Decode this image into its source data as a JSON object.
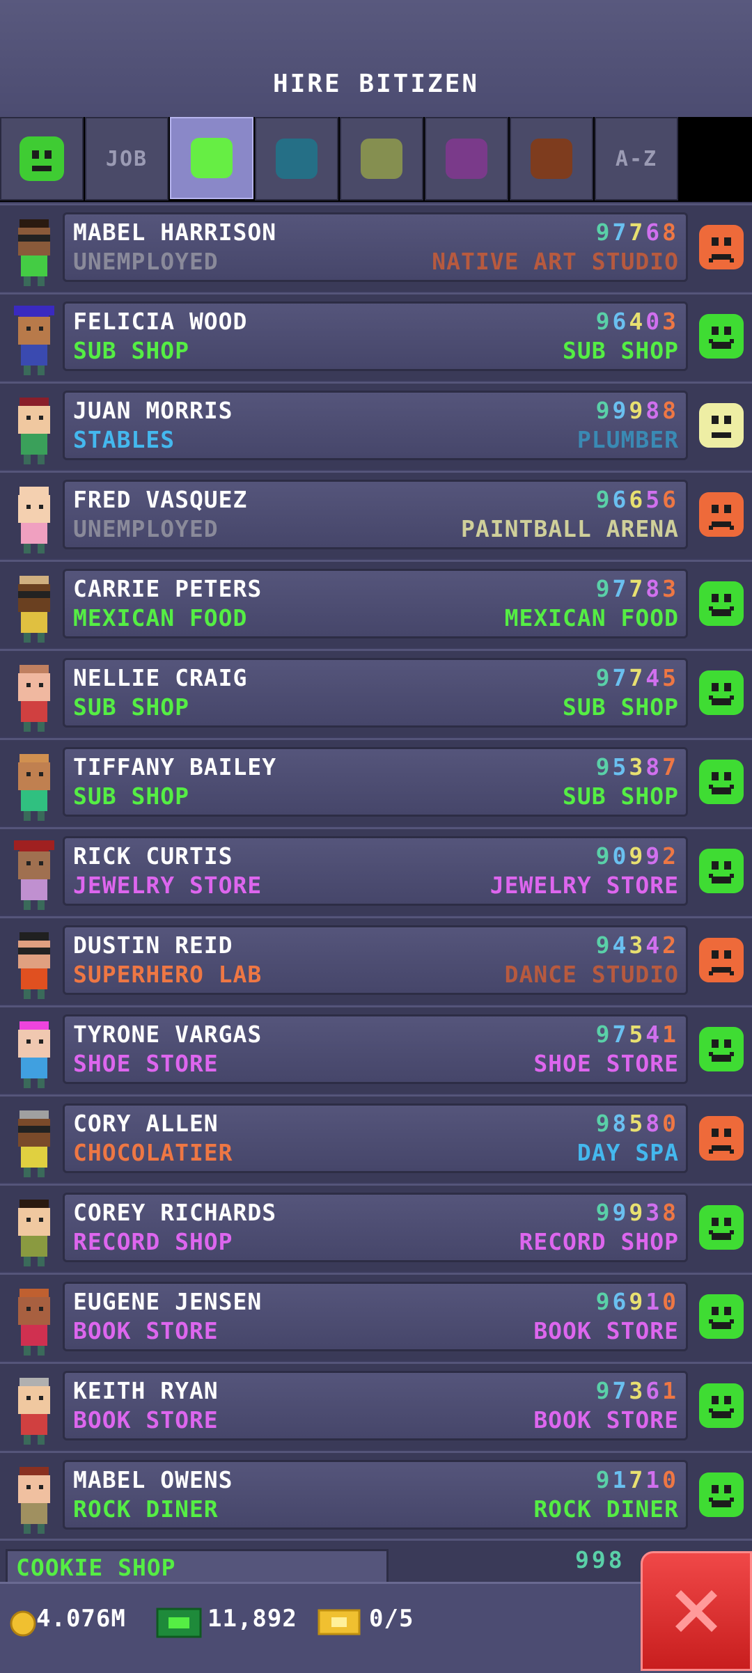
{
  "header": {
    "title": "HIRE BITIZEN"
  },
  "tabs": [
    {
      "type": "mood",
      "icon": "smiley-icon",
      "color": "#3fcc33"
    },
    {
      "type": "text",
      "label": "JOB"
    },
    {
      "type": "swatch",
      "color": "#66ee44",
      "active": true
    },
    {
      "type": "swatch",
      "color": "#256f86"
    },
    {
      "type": "swatch",
      "color": "#858f50"
    },
    {
      "type": "swatch",
      "color": "#7a3a8a"
    },
    {
      "type": "swatch",
      "color": "#7e3c1e"
    },
    {
      "type": "text",
      "label": "A-Z"
    }
  ],
  "colors": {
    "unemployed": "#8a8a9a",
    "food": "#55ee44",
    "service": "#44b8ee",
    "creative": "#dd66ee",
    "recreation": "#ee7744",
    "retail": "#dd66ee",
    "food_dream": "#55ee44",
    "paintball": "#cfcf9a",
    "happy": "#3fdc33",
    "neutral": "#eeeea4",
    "sad": "#ee6a3a"
  },
  "rows": [
    {
      "name": "MABEL HARRISON",
      "job": "UNEMPLOYED",
      "job_color": "#8a8a9a",
      "dream": "NATIVE ART STUDIO",
      "dream_color": "#b75a3f",
      "stats": [
        "9",
        "7",
        "7",
        "6",
        "8"
      ],
      "mood": "sad",
      "avatar": {
        "skin": "#8a5a3a",
        "hair": "#2a1a10",
        "shirt": "#44cc44",
        "glasses": true
      }
    },
    {
      "name": "FELICIA WOOD",
      "job": "SUB SHOP",
      "job_color": "#55ee44",
      "dream": "SUB SHOP",
      "dream_color": "#55ee44",
      "stats": [
        "9",
        "6",
        "4",
        "0",
        "3"
      ],
      "mood": "happy",
      "avatar": {
        "skin": "#b87a4a",
        "hair": "#3a2ac0",
        "shirt": "#3a4ab0",
        "hat": true
      }
    },
    {
      "name": "JUAN MORRIS",
      "job": "STABLES",
      "job_color": "#44b8ee",
      "dream": "PLUMBER",
      "dream_color": "#3a8ab4",
      "stats": [
        "9",
        "9",
        "9",
        "8",
        "8"
      ],
      "mood": "neutral",
      "avatar": {
        "skin": "#f0c8a0",
        "hair": "#8a1e2a",
        "shirt": "#3aa05a"
      }
    },
    {
      "name": "FRED VASQUEZ",
      "job": "UNEMPLOYED",
      "job_color": "#8a8a9a",
      "dream": "PAINTBALL ARENA",
      "dream_color": "#cfcf9a",
      "stats": [
        "9",
        "6",
        "6",
        "5",
        "6"
      ],
      "mood": "sad",
      "avatar": {
        "skin": "#f4d0b0",
        "hair": "#f4d0b0",
        "shirt": "#f0a0c0"
      }
    },
    {
      "name": "CARRIE PETERS",
      "job": "MEXICAN FOOD",
      "job_color": "#55ee44",
      "dream": "MEXICAN FOOD",
      "dream_color": "#55ee44",
      "stats": [
        "9",
        "7",
        "7",
        "8",
        "3"
      ],
      "mood": "happy",
      "avatar": {
        "skin": "#6a4020",
        "hair": "#d0b080",
        "shirt": "#e0c040",
        "glasses": true
      }
    },
    {
      "name": "NELLIE CRAIG",
      "job": "SUB SHOP",
      "job_color": "#55ee44",
      "dream": "SUB SHOP",
      "dream_color": "#55ee44",
      "stats": [
        "9",
        "7",
        "7",
        "4",
        "5"
      ],
      "mood": "happy",
      "avatar": {
        "skin": "#f0b8a0",
        "hair": "#c08060",
        "shirt": "#d04040"
      }
    },
    {
      "name": "TIFFANY BAILEY",
      "job": "SUB SHOP",
      "job_color": "#55ee44",
      "dream": "SUB SHOP",
      "dream_color": "#55ee44",
      "stats": [
        "9",
        "5",
        "3",
        "8",
        "7"
      ],
      "mood": "happy",
      "avatar": {
        "skin": "#c08050",
        "hair": "#d09050",
        "shirt": "#30c080"
      }
    },
    {
      "name": "RICK CURTIS",
      "job": "JEWELRY STORE",
      "job_color": "#dd66ee",
      "dream": "JEWELRY STORE",
      "dream_color": "#dd66ee",
      "stats": [
        "9",
        "0",
        "9",
        "9",
        "2"
      ],
      "mood": "happy",
      "avatar": {
        "skin": "#a07050",
        "hair": "#a02020",
        "shirt": "#c090d0",
        "hat": true
      }
    },
    {
      "name": "DUSTIN REID",
      "job": "SUPERHERO LAB",
      "job_color": "#ee7744",
      "dream": "DANCE STUDIO",
      "dream_color": "#b75a3f",
      "stats": [
        "9",
        "4",
        "3",
        "4",
        "2"
      ],
      "mood": "sad",
      "avatar": {
        "skin": "#e0a080",
        "hair": "#202020",
        "shirt": "#e05020",
        "glasses": true
      }
    },
    {
      "name": "TYRONE VARGAS",
      "job": "SHOE STORE",
      "job_color": "#dd66ee",
      "dream": "SHOE STORE",
      "dream_color": "#dd66ee",
      "stats": [
        "9",
        "7",
        "5",
        "4",
        "1"
      ],
      "mood": "happy",
      "avatar": {
        "skin": "#f0c8b0",
        "hair": "#ee44dd",
        "shirt": "#40a0e0"
      }
    },
    {
      "name": "CORY ALLEN",
      "job": "CHOCOLATIER",
      "job_color": "#ee7744",
      "dream": "DAY SPA",
      "dream_color": "#44b8ee",
      "stats": [
        "9",
        "8",
        "5",
        "8",
        "0"
      ],
      "mood": "sad",
      "avatar": {
        "skin": "#7a4a2a",
        "hair": "#a0a0a0",
        "shirt": "#e0d040",
        "glasses": true
      }
    },
    {
      "name": "COREY RICHARDS",
      "job": "RECORD SHOP",
      "job_color": "#dd66ee",
      "dream": "RECORD SHOP",
      "dream_color": "#dd66ee",
      "stats": [
        "9",
        "9",
        "9",
        "3",
        "8"
      ],
      "mood": "happy",
      "avatar": {
        "skin": "#f0c8a0",
        "hair": "#2a1a10",
        "shirt": "#8a9a40"
      }
    },
    {
      "name": "EUGENE JENSEN",
      "job": "BOOK STORE",
      "job_color": "#dd66ee",
      "dream": "BOOK STORE",
      "dream_color": "#dd66ee",
      "stats": [
        "9",
        "6",
        "9",
        "1",
        "0"
      ],
      "mood": "happy",
      "avatar": {
        "skin": "#a86040",
        "hair": "#c06030",
        "shirt": "#d03050"
      }
    },
    {
      "name": "KEITH RYAN",
      "job": "BOOK STORE",
      "job_color": "#dd66ee",
      "dream": "BOOK STORE",
      "dream_color": "#dd66ee",
      "stats": [
        "9",
        "7",
        "3",
        "6",
        "1"
      ],
      "mood": "happy",
      "avatar": {
        "skin": "#f0c8a0",
        "hair": "#b0b0b0",
        "shirt": "#d04040"
      }
    },
    {
      "name": "MABEL OWENS",
      "job": "ROCK DINER",
      "job_color": "#55ee44",
      "dream": "ROCK DINER",
      "dream_color": "#55ee44",
      "stats": [
        "9",
        "1",
        "7",
        "1",
        "0"
      ],
      "mood": "happy",
      "avatar": {
        "skin": "#f0c0a0",
        "hair": "#8a3020",
        "shirt": "#a09060"
      }
    }
  ],
  "stat_colors": [
    "#5ad0a8",
    "#6ac0f0",
    "#e8e070",
    "#d070ee",
    "#ee7744"
  ],
  "partial_row": {
    "job": "COOKIE SHOP",
    "stats": "998"
  },
  "bottom": {
    "coins": "4.076M",
    "bux": "11,892",
    "tickets": "0/5"
  }
}
